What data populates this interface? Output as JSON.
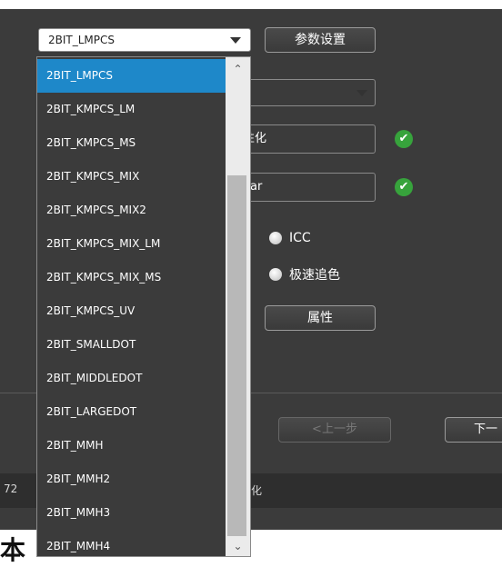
{
  "mode_select": {
    "value": "2BIT_LMPCS"
  },
  "param_button": "参数设置",
  "partial_fields": {
    "line1": "性化",
    "line2": "ear"
  },
  "radios": [
    {
      "label": "ICC"
    },
    {
      "label": "极速追色"
    }
  ],
  "attr_button": "属性",
  "nav": {
    "prev": "<上一步",
    "next": "下一"
  },
  "status": {
    "left": "72",
    "right": "化"
  },
  "dropdown": {
    "items": [
      {
        "label": "2BIT_LMPCS",
        "selected": true
      },
      {
        "label": "2BIT_KMPCS_LM",
        "selected": false
      },
      {
        "label": "2BIT_KMPCS_MS",
        "selected": false
      },
      {
        "label": "2BIT_KMPCS_MIX",
        "selected": false
      },
      {
        "label": "2BIT_KMPCS_MIX2",
        "selected": false
      },
      {
        "label": "2BIT_KMPCS_MIX_LM",
        "selected": false
      },
      {
        "label": "2BIT_KMPCS_MIX_MS",
        "selected": false
      },
      {
        "label": "2BIT_KMPCS_UV",
        "selected": false
      },
      {
        "label": "2BIT_SMALLDOT",
        "selected": false
      },
      {
        "label": "2BIT_MIDDLEDOT",
        "selected": false
      },
      {
        "label": "2BIT_LARGEDOT",
        "selected": false
      },
      {
        "label": "2BIT_MMH",
        "selected": false
      },
      {
        "label": "2BIT_MMH2",
        "selected": false
      },
      {
        "label": "2BIT_MMH3",
        "selected": false
      },
      {
        "label": "2BIT_MMH4",
        "selected": false
      }
    ]
  },
  "bottom_text": "本",
  "icons": {
    "check": "check-circle-icon",
    "dropdown": "chevron-down-icon",
    "scroll_up": "chevron-up-icon",
    "scroll_down": "chevron-down-icon"
  },
  "colors": {
    "panel": "#3b3b3b",
    "selected": "#1e88c9",
    "check": "#37a33c"
  }
}
